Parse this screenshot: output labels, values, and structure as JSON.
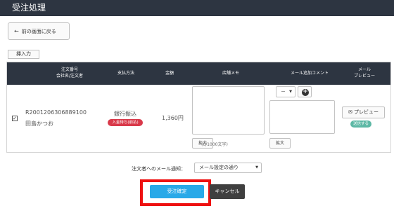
{
  "header": {
    "title": "受注処理"
  },
  "toolbar": {
    "back_label": "前の画面に戻る",
    "insert_label": "挿入力"
  },
  "table": {
    "columns": {
      "order_no": "注文番号",
      "company": "会社名/注文者",
      "payment": "支払方法",
      "amount": "金額",
      "shop_memo": "店舗メモ",
      "mail_comment": "メール追加コメント",
      "mail_preview_1": "メール",
      "mail_preview_2": "プレビュー"
    },
    "row": {
      "checked": true,
      "order_no": "R2001206306889100",
      "customer": "田島かつお",
      "payment": "銀行振込",
      "payment_badge": "入金待ち(前払)",
      "amount": "1,360円",
      "expand_label": "拡大",
      "counter": "(0/1000文字)",
      "dash_option": "－",
      "expand2_label": "拡大",
      "preview_label": "プレビュー",
      "send_badge": "送信する"
    }
  },
  "notify": {
    "label": "注文者へのメール通知：",
    "selected": "メール設定の通り"
  },
  "actions": {
    "confirm_label": "受注確定",
    "cancel_label": "キャンセル"
  },
  "colors": {
    "header_bg": "#2d3541",
    "confirm": "#29a9e8",
    "cancel": "#3f3f3f",
    "highlight": "#ee1111",
    "badge_red": "#d9394a",
    "badge_teal": "#5db8a5"
  }
}
